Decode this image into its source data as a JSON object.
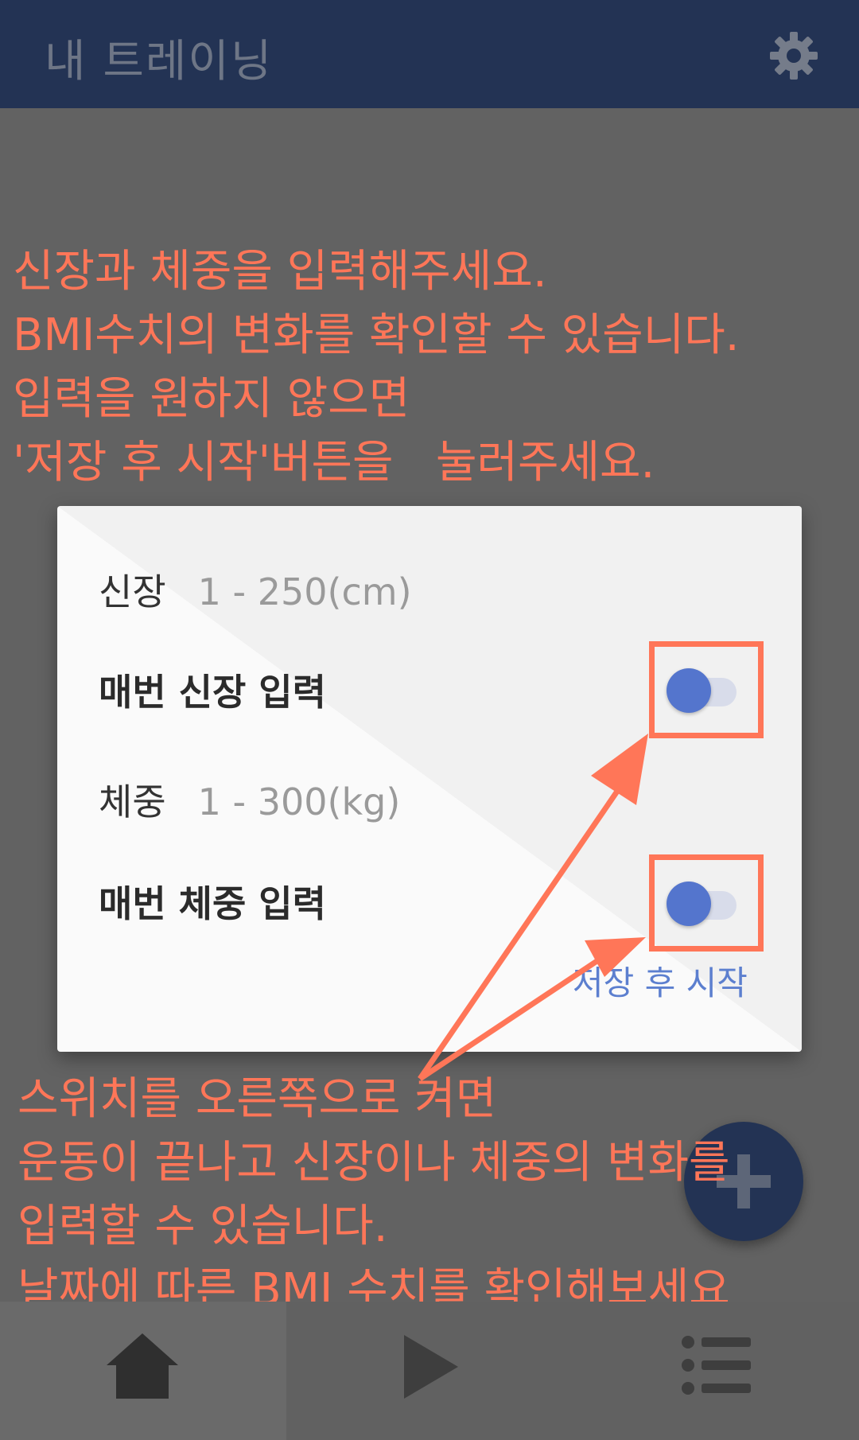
{
  "appbar": {
    "title": "내 트레이닝",
    "settings_icon": "gear-icon"
  },
  "overlay_top": {
    "lines": [
      "신장과 체중을 입력해주세요.",
      "BMI수치의 변화를 확인할 수 있습니다.",
      "입력을 원하지 않으면",
      "'저장 후 시작'버튼을   눌러주세요."
    ]
  },
  "dialog": {
    "height_label": "신장",
    "height_placeholder": "1 - 250(cm)",
    "height_toggle_label": "매번 신장 입력",
    "weight_label": "체중",
    "weight_placeholder": "1 - 300(kg)",
    "weight_toggle_label": "매번 체중 입력",
    "save_button": "저장 후 시작",
    "height_toggle_on": false,
    "weight_toggle_on": false
  },
  "overlay_bottom": {
    "lines": [
      "스위치를 오른쪽으로 켜면",
      "운동이 끝나고 신장이나 체중의 변화를",
      "입력할 수 있습니다.",
      "날짜에 따른 BMI 수치를 확인해보세요"
    ]
  },
  "fab": {
    "icon": "plus-icon"
  },
  "bottom_nav": {
    "items": [
      {
        "icon": "home-icon"
      },
      {
        "icon": "play-icon"
      },
      {
        "icon": "list-icon"
      }
    ]
  },
  "colors": {
    "appbar": "#233354",
    "overlay_text": "#ff7658",
    "accent": "#5475cd",
    "dim_background": "#626262"
  }
}
